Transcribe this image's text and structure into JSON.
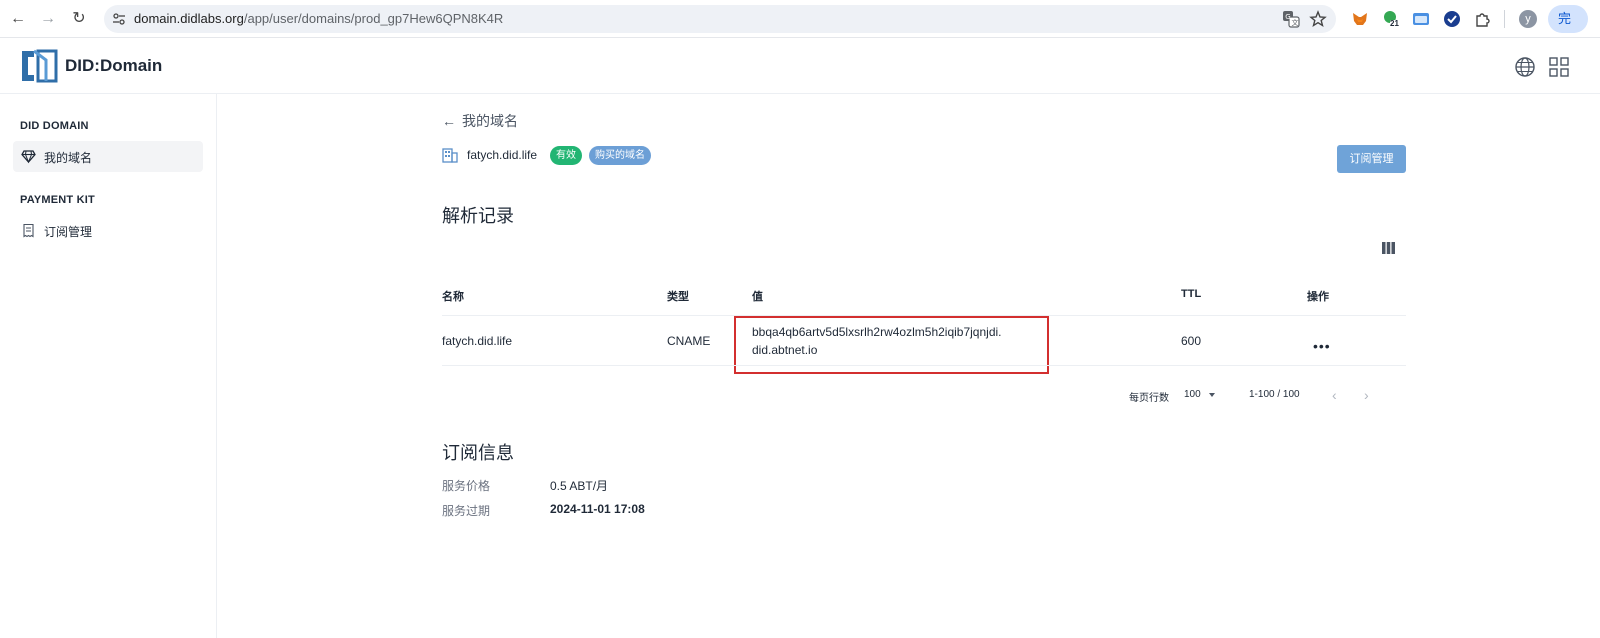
{
  "browser": {
    "url_host": "domain.didlabs.org",
    "url_path": "/app/user/domains/prod_gp7Hew6QPN8K4R",
    "badge_count": "21",
    "profile_initial": "y",
    "complete_label": "完"
  },
  "header": {
    "brand": "DID:Domain"
  },
  "sidebar": {
    "section1": "DID DOMAIN",
    "item1": "我的域名",
    "section2": "PAYMENT KIT",
    "item2": "订阅管理"
  },
  "main": {
    "back_label": "我的域名",
    "domain_name": "fatych.did.life",
    "badge_valid": "有效",
    "badge_bought": "购买的域名",
    "subscription_button": "订阅管理",
    "records_title": "解析记录",
    "table": {
      "headers": [
        "名称",
        "类型",
        "值",
        "TTL",
        "操作"
      ],
      "rows": [
        {
          "name": "fatych.did.life",
          "type": "CNAME",
          "value_line1": "bbqa4qb6artv5d5lxsrlh2rw4ozlm5h2iqib7jqnjdi.",
          "value_line2": "did.abtnet.io",
          "ttl": "600"
        }
      ]
    },
    "pager": {
      "rows_per_page_label": "每页行数",
      "rows_per_page": "100",
      "range": "1-100 / 100"
    },
    "subscription_title": "订阅信息",
    "price_label": "服务价格",
    "price_value": "0.5 ABT/月",
    "expire_label": "服务过期",
    "expire_value": "2024-11-01 17:08"
  }
}
